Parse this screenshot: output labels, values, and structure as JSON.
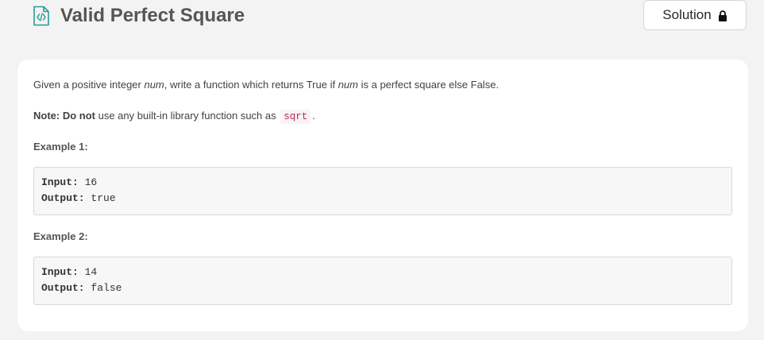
{
  "header": {
    "title": "Valid Perfect Square",
    "title_icon": "code-file-icon",
    "solution_label": "Solution",
    "solution_icon": "lock-icon"
  },
  "description": {
    "part1": "Given a positive integer ",
    "var1": "num",
    "part2": ", write a function which returns True if ",
    "var2": "num",
    "part3": " is a perfect square else False."
  },
  "note": {
    "label": "Note:",
    "do_not": "Do not",
    "text": " use any built-in library function such as ",
    "code": "sqrt",
    "end": "."
  },
  "examples": [
    {
      "heading": "Example 1:",
      "input_label": "Input:",
      "input_value": " 16",
      "output_label": "Output:",
      "output_value": " true"
    },
    {
      "heading": "Example 2:",
      "input_label": "Input:",
      "input_value": " 14",
      "output_label": "Output:",
      "output_value": " false"
    }
  ],
  "colors": {
    "page_bg": "#f3f3f3",
    "card_bg": "#ffffff",
    "icon_teal": "#2c9a9b",
    "inline_code": "#c7254e"
  }
}
